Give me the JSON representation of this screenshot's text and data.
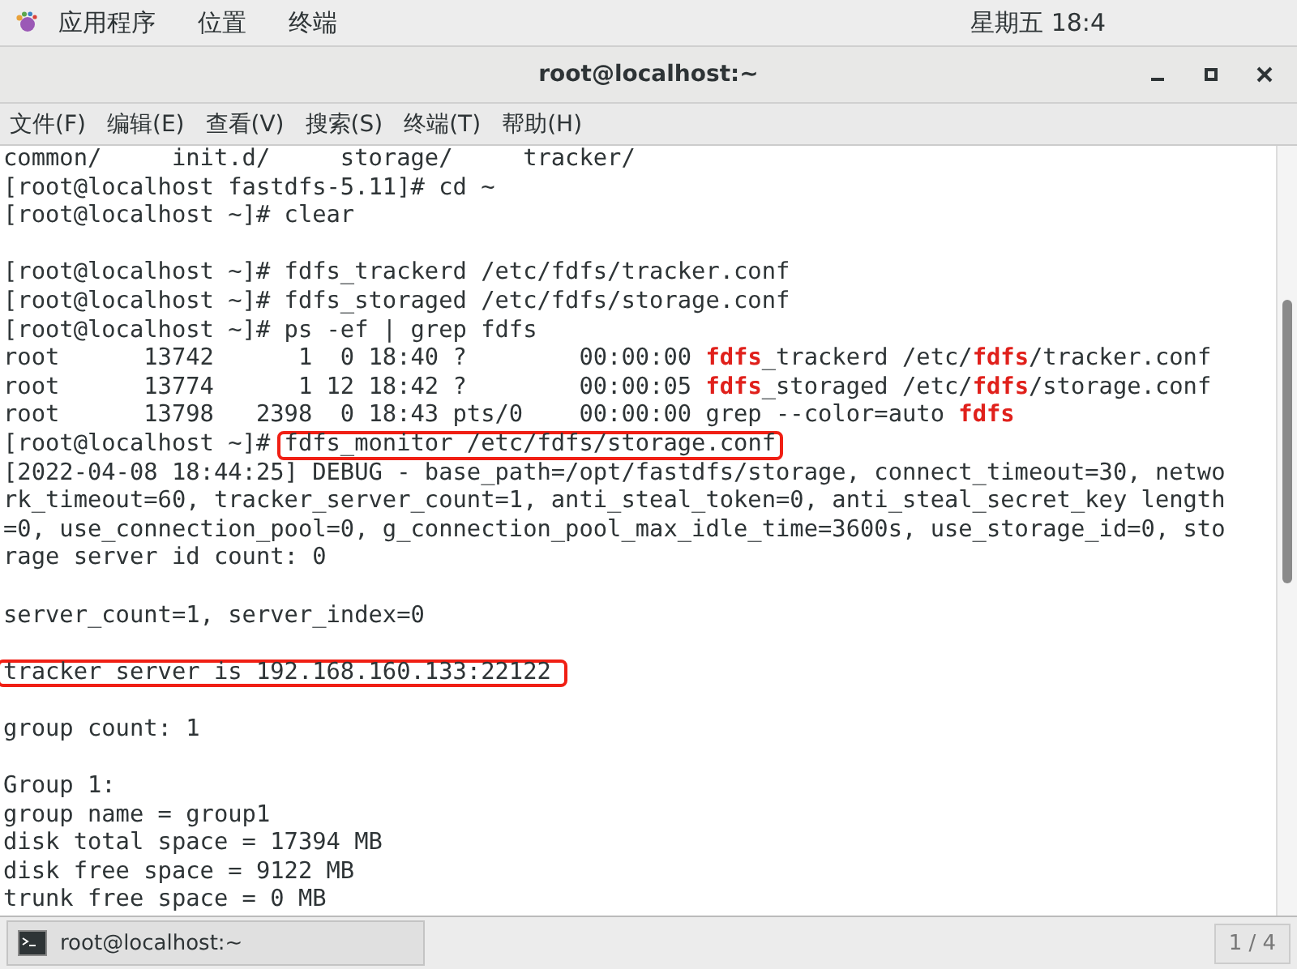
{
  "top_bar": {
    "menus": [
      "应用程序",
      "位置",
      "终端"
    ],
    "clock": "星期五 18:4"
  },
  "window": {
    "title": "root@localhost:~"
  },
  "menu_bar": [
    "文件(F)",
    "编辑(E)",
    "查看(V)",
    "搜索(S)",
    "终端(T)",
    "帮助(H)"
  ],
  "terminal": {
    "lines": [
      {
        "kind": "plain",
        "text": "common/     init.d/     storage/     tracker/"
      },
      {
        "kind": "plain",
        "text": "[root@localhost fastdfs-5.11]# cd ~"
      },
      {
        "kind": "plain",
        "text": "[root@localhost ~]# clear"
      },
      {
        "kind": "blank"
      },
      {
        "kind": "plain",
        "text": "[root@localhost ~]# fdfs_trackerd /etc/fdfs/tracker.conf"
      },
      {
        "kind": "plain",
        "text": "[root@localhost ~]# fdfs_storaged /etc/fdfs/storage.conf"
      },
      {
        "kind": "plain",
        "text": "[root@localhost ~]# ps -ef | grep fdfs"
      },
      {
        "kind": "match",
        "parts": [
          {
            "text": "root      13742      1  0 18:40 ?        00:00:00 ",
            "match": false
          },
          {
            "text": "fdfs",
            "match": true
          },
          {
            "text": "_trackerd /etc/",
            "match": false
          },
          {
            "text": "fdfs",
            "match": true
          },
          {
            "text": "/tracker.conf",
            "match": false
          }
        ]
      },
      {
        "kind": "match",
        "parts": [
          {
            "text": "root      13774      1 12 18:42 ?        00:00:05 ",
            "match": false
          },
          {
            "text": "fdfs",
            "match": true
          },
          {
            "text": "_storaged /etc/",
            "match": false
          },
          {
            "text": "fdfs",
            "match": true
          },
          {
            "text": "/storage.conf",
            "match": false
          }
        ]
      },
      {
        "kind": "match",
        "parts": [
          {
            "text": "root      13798   2398  0 18:43 pts/0    00:00:00 grep --color=auto ",
            "match": false
          },
          {
            "text": "fdfs",
            "match": true
          }
        ]
      },
      {
        "kind": "boxed",
        "prefix": "[root@localhost ~]# ",
        "text": "fdfs_monitor /etc/fdfs/storage.conf"
      },
      {
        "kind": "plain",
        "text": "[2022-04-08 18:44:25] DEBUG - base_path=/opt/fastdfs/storage, connect_timeout=30, netwo"
      },
      {
        "kind": "plain",
        "text": "rk_timeout=60, tracker_server_count=1, anti_steal_token=0, anti_steal_secret_key length"
      },
      {
        "kind": "plain",
        "text": "=0, use_connection_pool=0, g_connection_pool_max_idle_time=3600s, use_storage_id=0, sto"
      },
      {
        "kind": "plain",
        "text": "rage server id count: 0"
      },
      {
        "kind": "blank"
      },
      {
        "kind": "plain",
        "text": "server_count=1, server_index=0"
      },
      {
        "kind": "blank"
      },
      {
        "kind": "boxed",
        "text": "tracker server is 192.168.160.133:22122"
      },
      {
        "kind": "blank"
      },
      {
        "kind": "plain",
        "text": "group count: 1"
      },
      {
        "kind": "blank"
      },
      {
        "kind": "plain",
        "text": "Group 1:"
      },
      {
        "kind": "plain",
        "text": "group name = group1"
      },
      {
        "kind": "plain",
        "text": "disk total space = 17394 MB"
      },
      {
        "kind": "plain",
        "text": "disk free space = 9122 MB"
      },
      {
        "kind": "plain",
        "text": "trunk free space = 0 MB"
      }
    ]
  },
  "taskbar": {
    "tasks": [
      {
        "label": "root@localhost:~",
        "selected": false
      }
    ],
    "workspace": "1 / 4"
  }
}
